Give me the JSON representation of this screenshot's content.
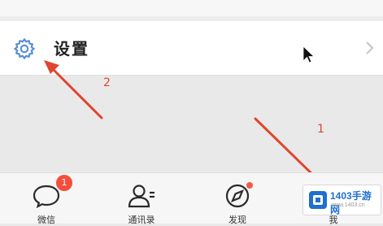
{
  "settings": {
    "label": "设置",
    "icon": "gear-icon",
    "chevron_icon": "chevron-right-icon"
  },
  "annotations": {
    "marker_1": "1",
    "marker_2": "2",
    "arrow_color": "#e0452f"
  },
  "tabbar": {
    "tabs": [
      {
        "label": "微信",
        "icon": "chat-bubble-icon",
        "badge": "1"
      },
      {
        "label": "通讯录",
        "icon": "contacts-icon"
      },
      {
        "label": "发现",
        "icon": "compass-icon",
        "dot": true
      },
      {
        "label": "我",
        "icon": "person-icon"
      }
    ]
  },
  "watermark": {
    "text": "1403手游网",
    "sub": "www.1403.cn"
  },
  "colors": {
    "accent": "#5a8fd6",
    "badge": "#f44e3b"
  }
}
